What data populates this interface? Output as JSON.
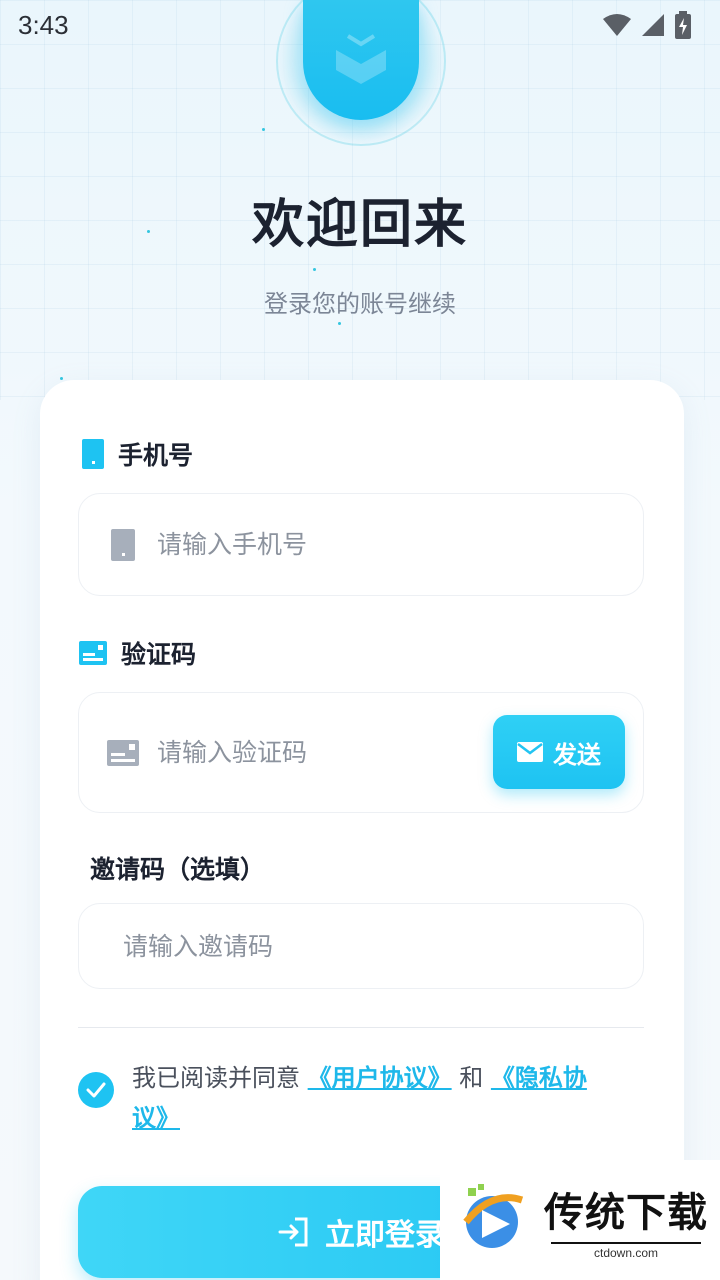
{
  "status_bar": {
    "time": "3:43"
  },
  "header": {
    "title": "欢迎回来",
    "subtitle": "登录您的账号继续"
  },
  "form": {
    "phone": {
      "label": "手机号",
      "placeholder": "请输入手机号"
    },
    "code": {
      "label": "验证码",
      "placeholder": "请输入验证码",
      "send_label": "发送"
    },
    "invite": {
      "label": "邀请码（选填）",
      "placeholder": "请输入邀请码"
    }
  },
  "agreement": {
    "prefix": "我已阅读并同意 ",
    "user_agreement": "《用户协议》",
    "and": " 和 ",
    "privacy_policy": "《隐私协议》",
    "checked": true
  },
  "login_button": {
    "label": "立即登录"
  },
  "watermark": {
    "title": "传统下载",
    "url": "ctdown.com"
  },
  "colors": {
    "accent": "#1ec3f2",
    "title": "#1c2230",
    "muted": "#8c939e"
  }
}
